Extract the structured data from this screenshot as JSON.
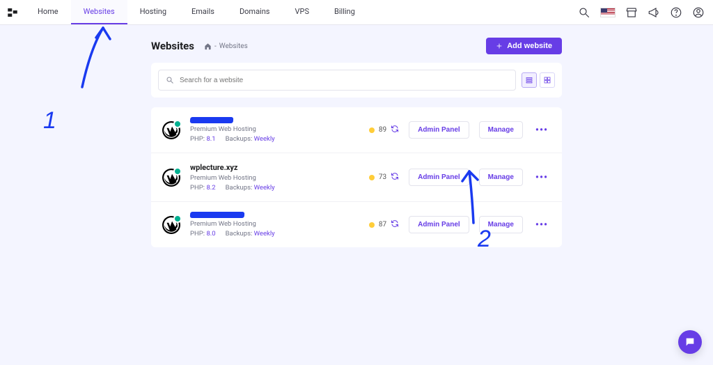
{
  "nav": {
    "tabs": [
      "Home",
      "Websites",
      "Hosting",
      "Emails",
      "Domains",
      "VPS",
      "Billing"
    ],
    "active_index": 1
  },
  "page": {
    "title": "Websites",
    "breadcrumb_sep": "-",
    "breadcrumb_current": "Websites",
    "add_button": "Add website"
  },
  "search": {
    "placeholder": "Search for a website"
  },
  "sites": [
    {
      "name_redacted": true,
      "plan": "Premium Web Hosting",
      "php_label": "PHP:",
      "php_version": "8.1",
      "backups_label": "Backups:",
      "backups_value": "Weekly",
      "score": "89",
      "admin_label": "Admin Panel",
      "manage_label": "Manage"
    },
    {
      "name_redacted": false,
      "name": "wplecture.xyz",
      "plan": "Premium Web Hosting",
      "php_label": "PHP:",
      "php_version": "8.2",
      "backups_label": "Backups:",
      "backups_value": "Weekly",
      "score": "73",
      "admin_label": "Admin Panel",
      "manage_label": "Manage"
    },
    {
      "name_redacted": true,
      "plan": "Premium Web Hosting",
      "php_label": "PHP:",
      "php_version": "8.0",
      "backups_label": "Backups:",
      "backups_value": "Weekly",
      "score": "87",
      "admin_label": "Admin Panel",
      "manage_label": "Manage"
    }
  ],
  "annotations": {
    "label1": "1",
    "label2": "2"
  }
}
